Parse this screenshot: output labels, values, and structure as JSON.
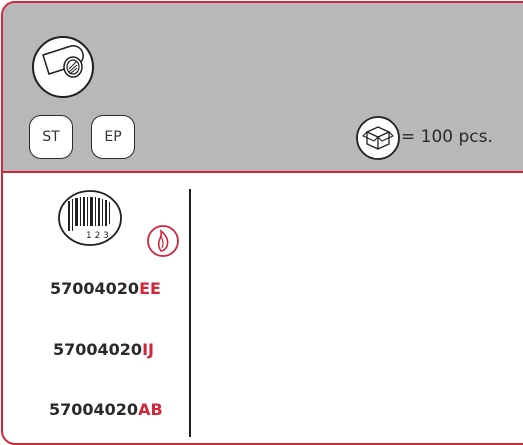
{
  "header": {
    "buttons": [
      {
        "label": "ST"
      },
      {
        "label": "EP"
      }
    ],
    "quantity_text": "= 100 pcs."
  },
  "product_codes": [
    {
      "base": "57004020",
      "suffix": "EE"
    },
    {
      "base": "57004020",
      "suffix": "IJ"
    },
    {
      "base": "57004020",
      "suffix": "AB"
    }
  ],
  "icons": {
    "spool": "cable-spool-icon",
    "box": "package-box-icon",
    "barcode": "barcode-icon",
    "barcode_digits": "1 2 3",
    "flame": "flame-icon"
  },
  "colors": {
    "accent": "#d2263b",
    "header_bg": "#b8b8b8",
    "text": "#2a2a2a"
  }
}
